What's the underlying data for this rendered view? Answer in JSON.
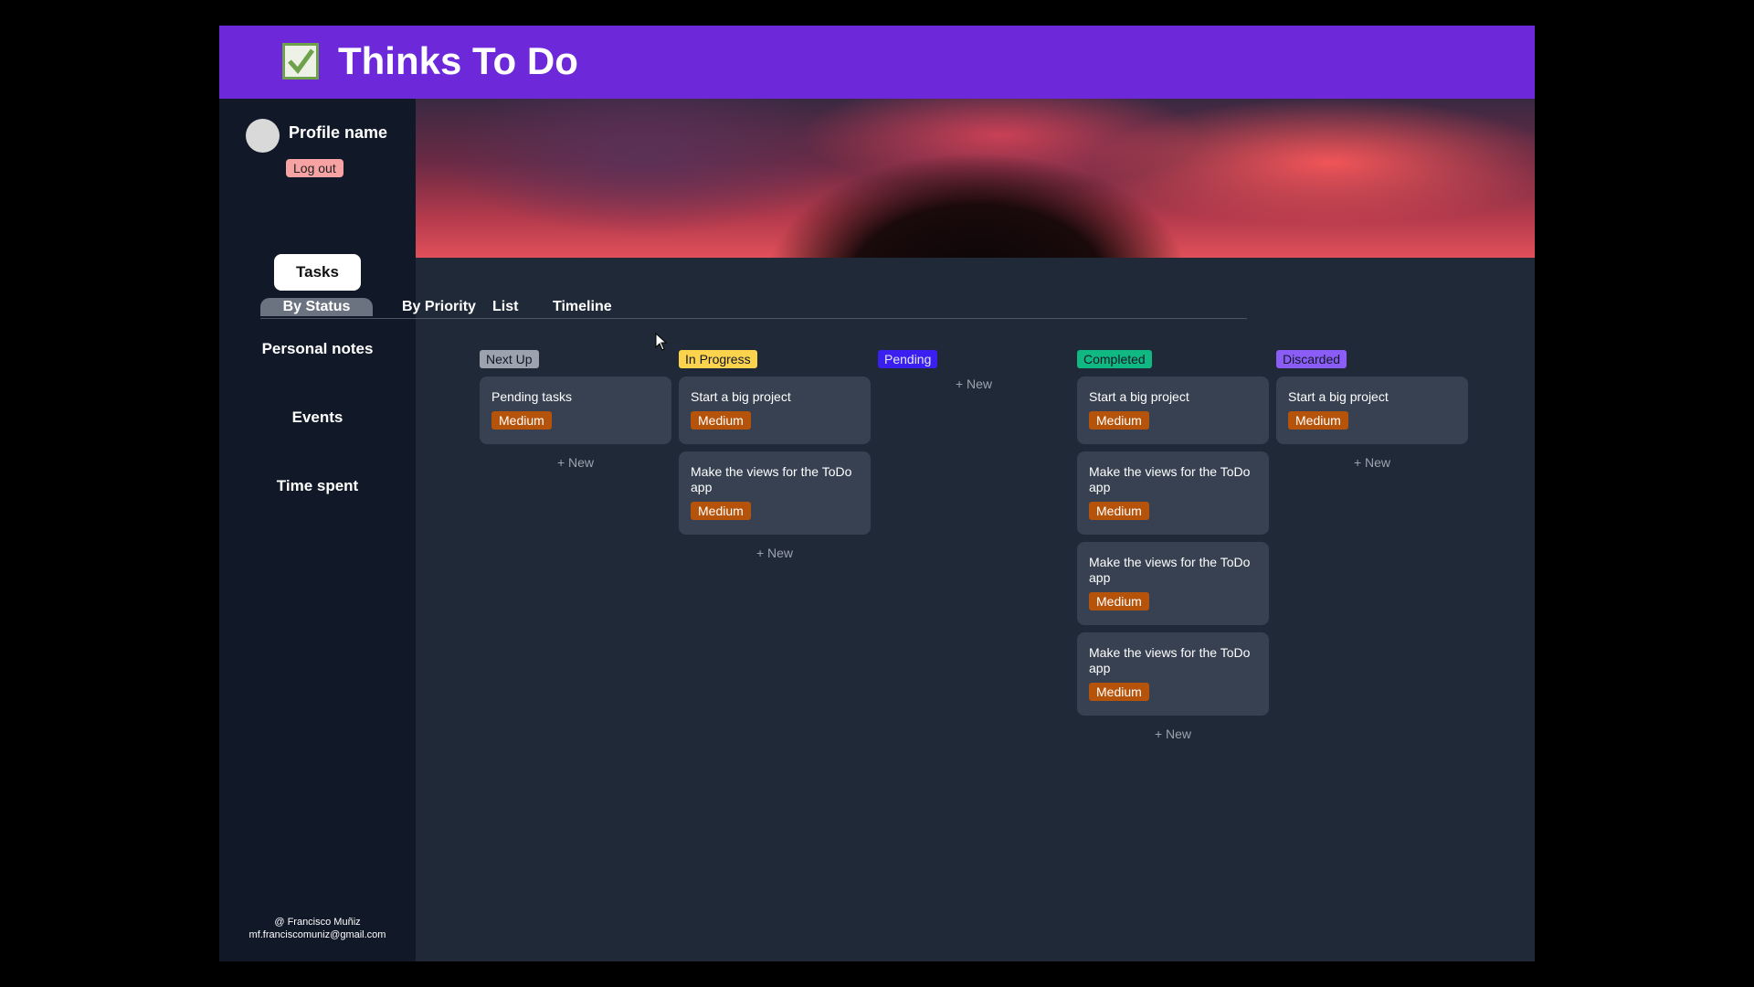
{
  "header": {
    "title": "Thinks To Do",
    "logo_icon": "check-box-icon"
  },
  "sidebar": {
    "profile_name": "Profile name",
    "logout_label": "Log out",
    "nav": [
      {
        "label": "Tasks",
        "active": true
      },
      {
        "label": "Personal notes"
      },
      {
        "label": "Events"
      },
      {
        "label": "Time spent"
      }
    ],
    "footer": {
      "line1": "@ Francisco Muñiz",
      "line2": "mf.franciscomuniz@gmail.com"
    }
  },
  "tabs": [
    "By Status",
    "By Priority",
    "List",
    "Timeline"
  ],
  "new_label": "+ New",
  "columns": [
    {
      "name": "Next Up",
      "color": "#9ca3af",
      "text_color": "#111827",
      "cards": [
        {
          "title": "Pending tasks",
          "priority": "Medium"
        }
      ]
    },
    {
      "name": "In Progress",
      "color": "#fcd34d",
      "text_color": "#111827",
      "cards": [
        {
          "title": "Start a big project",
          "priority": "Medium"
        },
        {
          "title": "Make the views for the ToDo app",
          "priority": "Medium"
        }
      ]
    },
    {
      "name": "Pending",
      "color": "#3b1ff0",
      "text_color": "#e5e7eb",
      "cards": []
    },
    {
      "name": "Completed",
      "color": "#10b981",
      "text_color": "#111827",
      "cards": [
        {
          "title": "Start a big project",
          "priority": "Medium"
        },
        {
          "title": "Make the views for the ToDo app",
          "priority": "Medium"
        },
        {
          "title": "Make the views for the ToDo app",
          "priority": "Medium"
        },
        {
          "title": "Make the views for the ToDo app",
          "priority": "Medium"
        }
      ]
    },
    {
      "name": "Discarded",
      "color": "#8b5cf6",
      "text_color": "#111827",
      "cards": [
        {
          "title": "Start a big project",
          "priority": "Medium"
        }
      ]
    }
  ],
  "colors": {
    "header": "#6d28d9",
    "sidebar": "#111827",
    "main": "#1f2937",
    "card": "#374151",
    "priority_medium": "#b45309"
  }
}
